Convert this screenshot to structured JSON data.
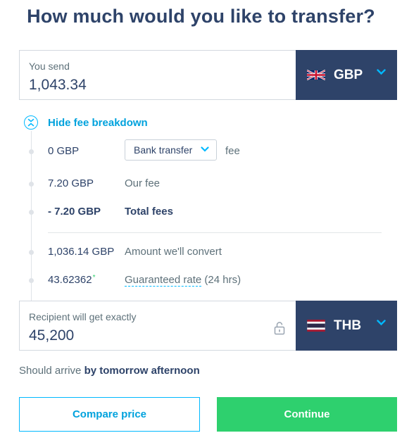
{
  "title": "How much would you like to transfer?",
  "send": {
    "label": "You send",
    "amount": "1,043.34",
    "currency": "GBP"
  },
  "fee_breakdown": {
    "toggle_label": "Hide fee breakdown",
    "payment_method_amount": "0 GBP",
    "payment_method_selected": "Bank transfer",
    "payment_method_suffix": "fee",
    "our_fee_amount": "7.20 GBP",
    "our_fee_label": "Our fee",
    "total_fees_amount": "- 7.20 GBP",
    "total_fees_label": "Total fees",
    "convert_amount": "1,036.14 GBP",
    "convert_label": "Amount we'll convert",
    "rate_value": "43.62362",
    "rate_marker": "*",
    "rate_label": "Guaranteed rate",
    "rate_duration": "(24 hrs)"
  },
  "receive": {
    "label": "Recipient will get exactly",
    "amount": "45,200",
    "currency": "THB"
  },
  "eta": {
    "prefix": "Should arrive",
    "value": "by tomorrow afternoon"
  },
  "buttons": {
    "compare": "Compare price",
    "continue": "Continue"
  },
  "colors": {
    "navy": "#2e4369",
    "accent_blue": "#00b9ff",
    "accent_green": "#2ed06e"
  }
}
